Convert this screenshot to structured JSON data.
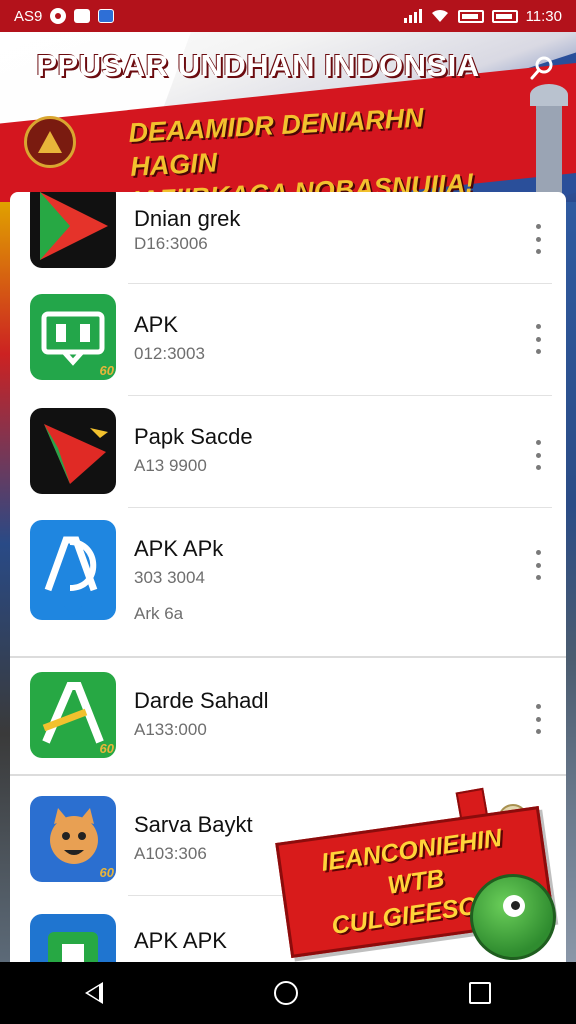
{
  "status_bar": {
    "carrier": "AS9",
    "time": "11:30"
  },
  "header": {
    "title": "PPUSAR UNDHAN INDONSIA",
    "subtitle_line1": "DEAAMIDR DENIARHN HAGIN",
    "subtitle_line2": "IAFIIBKACA NOBASNUIIA!"
  },
  "apps": [
    {
      "name": "Dnian grek",
      "meta": "D16:3006",
      "icon": "play-arrow-icon",
      "badge": ""
    },
    {
      "name": "APK",
      "meta": "012:3003",
      "icon": "chat-book-icon",
      "badge": "60"
    },
    {
      "name": "Papk Sacde",
      "meta": "A13 9900",
      "icon": "red-play-icon",
      "badge": ""
    },
    {
      "name": "APK APk",
      "meta": "303 3004",
      "extra": "Ark 6a",
      "icon": "letter-a-icon",
      "badge": ""
    },
    {
      "name": "Darde Sahadl",
      "meta": "A133:000",
      "icon": "green-a-icon",
      "badge": "60"
    },
    {
      "name": "Sarva Baykt",
      "meta": "A103:306",
      "icon": "cat-face-icon",
      "badge": "60"
    },
    {
      "name": "APK APK",
      "meta": "",
      "icon": "green-frame-icon",
      "badge": ""
    }
  ],
  "promo": {
    "line1": "IEANCONIEHIN",
    "line2": "WTB CULGIEESOVI!"
  },
  "colors": {
    "header_red": "#d4161f",
    "header_gold": "#f2c12e",
    "status_red": "#b3121b"
  }
}
